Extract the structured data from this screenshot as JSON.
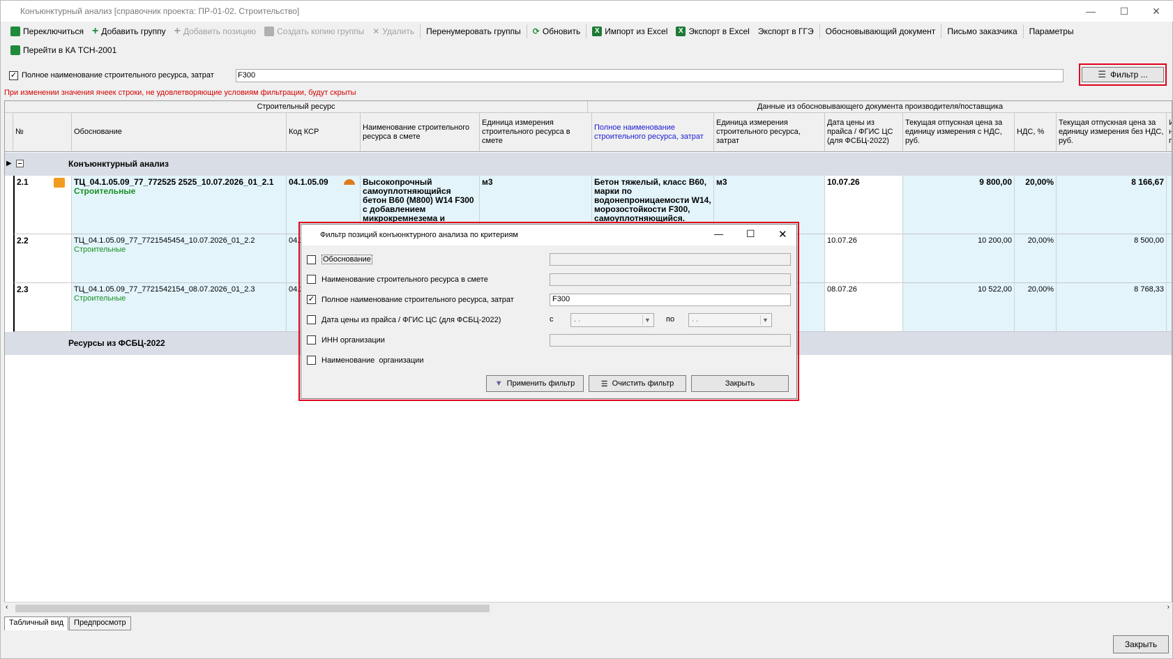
{
  "window": {
    "title": "Конъюнктурный анализ [справочник проекта: ПР-01-02. Строительство]"
  },
  "toolbar": {
    "switch": "Переключиться",
    "add_group": "Добавить группу",
    "add_position": "Добавить позицию",
    "copy_group": "Создать копию группы",
    "delete": "Удалить",
    "renumber": "Перенумеровать группы",
    "refresh": "Обновить",
    "import_excel": "Импорт из Excel",
    "export_excel": "Экспорт в Excel",
    "export_gge": "Экспорт в ГГЭ",
    "justifying_doc": "Обосновывающий документ",
    "customer_letter": "Письмо заказчика",
    "params": "Параметры",
    "go_ka": "Перейти в КА ТСН-2001"
  },
  "filterbar": {
    "checkbox_label": "Полное наименование строительного ресурса, затрат",
    "value": "F300",
    "filter_button": "Фильтр ...",
    "warning": "При изменении значения ячеек строки, не удовлетворяющие условиям фильтрации, будут скрыты"
  },
  "grid": {
    "group_headers": [
      "Строительный ресурс",
      "Данные из обосновывающего документа производителя/поставщика"
    ],
    "columns": [
      "№",
      "Обоснование",
      "Код КСР",
      "Наименование строительного ресурса в смете",
      "Единица измерения строительного ресурса в смете",
      "Полное наименование строительного ресурса, затрат",
      "Единица измерения строительного ресурса, затрат",
      "Дата цены из прайса / ФГИС ЦС (для ФСБЦ-2022)",
      "Текущая отпускная цена за единицу измерения с НДС, руб.",
      "НДС, %",
      "Текущая отпускная цена за единицу измерения без НДС, руб.",
      "И н п"
    ],
    "group_row": "Конъюнктурный анализ",
    "group_row2": "Ресурсы из ФСБЦ-2022",
    "rows": [
      {
        "num": "2.1",
        "basis": "ТЦ_04.1.05.09_77_772525 2525_10.07.2026_01_2.1",
        "category": "Строительные",
        "code": "04.1.05.09",
        "name": "Высокопрочный самоуплотняющийся бетон В60 (М800) W14 F300 с добавлением микрокремнезема и",
        "unit": "м3",
        "full_name": "Бетон тяжелый, класс В60, марки по водонепроницаемости W14, морозостойкости F300, самоуплотняющийся.",
        "full_unit": "м3",
        "date": "10.07.26",
        "price_vat": "9 800,00",
        "vat": "20,00%",
        "price": "8 166,67"
      },
      {
        "num": "2.2",
        "basis": "ТЦ_04.1.05.09_77_7721545454_10.07.2026_01_2.2",
        "category": "Строительные",
        "code": "04.1",
        "date": "10.07.26",
        "price_vat": "10 200,00",
        "vat": "20,00%",
        "price": "8 500,00"
      },
      {
        "num": "2.3",
        "basis": "ТЦ_04.1.05.09_77_7721542154_08.07.2026_01_2.3",
        "category": "Строительные",
        "code": "04.1",
        "date": "08.07.26",
        "price_vat": "10 522,00",
        "vat": "20,00%",
        "price": "8 768,33"
      }
    ]
  },
  "tabs": [
    "Табличный вид",
    "Предпросмотр"
  ],
  "close_button": "Закрыть",
  "dialog": {
    "title": "Фильтр позиций конъюнктурного анализа по критериям",
    "criteria": [
      {
        "label": "Обоснование",
        "checked": false
      },
      {
        "label": "Наименование строительного ресурса в смете",
        "checked": false
      },
      {
        "label": "Полное наименование строительного ресурса, затрат",
        "checked": true,
        "value": "F300"
      },
      {
        "label": "Дата цены из прайса / ФГИС ЦС (для ФСБЦ-2022)",
        "checked": false
      },
      {
        "label": "ИНН организации",
        "checked": false
      },
      {
        "label": "Наименование  организации",
        "checked": false
      }
    ],
    "date_from": "с",
    "date_to": "по",
    "date_placeholder": " .  .",
    "apply": "Применить фильтр",
    "clear": "Очистить фильтр",
    "close": "Закрыть"
  }
}
